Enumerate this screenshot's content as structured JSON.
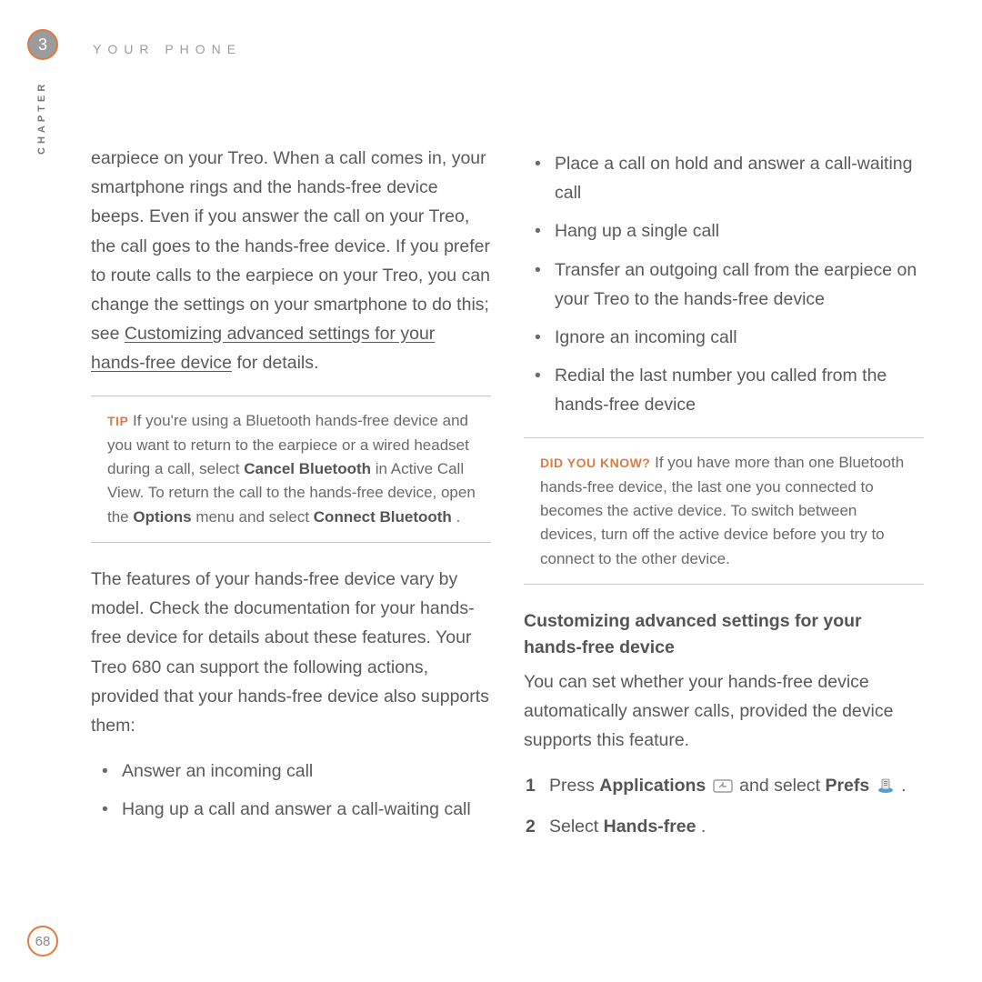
{
  "header": {
    "chapter_num": "3",
    "title": "YOUR PHONE",
    "sidelabel": "CHAPTER",
    "page_num": "68"
  },
  "left": {
    "p1a": "earpiece on your Treo. When a call comes in, your smartphone rings and the hands-free device beeps. Even if you answer the call on your Treo, the call goes to the hands-free device. If you prefer to route calls to the earpiece on your Treo, you can change the settings on your smartphone to do this; see ",
    "p1link": "Customizing advanced settings for your hands-free device",
    "p1b": " for details.",
    "tip": {
      "label": "TIP",
      "t1": "If you're using a Bluetooth hands-free device and you want to return to the earpiece or a wired headset during a call, select ",
      "b1": "Cancel Bluetooth",
      "t2": " in Active Call View. To return the call to the hands-free device, open the ",
      "b2": "Options",
      "t3": " menu and select ",
      "b3": "Connect Bluetooth",
      "t4": "."
    },
    "p2": "The features of your hands-free device vary by model. Check the documentation for your hands-free device for details about these features. Your Treo 680 can support the following actions, provided that your hands-free device also supports them:",
    "bullets": [
      "Answer an incoming call",
      "Hang up a call and answer a call-waiting call"
    ]
  },
  "right": {
    "bullets": [
      "Place a call on hold and answer a call-waiting call",
      "Hang up a single call",
      "Transfer an outgoing call from the earpiece on your Treo to the hands-free device",
      "Ignore an incoming call",
      "Redial the last number you called from the hands-free device"
    ],
    "dyk": {
      "label": "DID YOU KNOW?",
      "text": "If you have more than one Bluetooth hands-free device, the last one you connected to becomes the active device. To switch between devices, turn off the active device before you try to connect to the other device."
    },
    "h3": "Customizing advanced settings for your hands-free device",
    "p2": "You can set whether your hands-free device automatically answer calls, provided the device supports this feature.",
    "steps": {
      "s1a": "Press ",
      "s1b": "Applications",
      "s1c": " and select ",
      "s1d": "Prefs",
      "s1e": " .",
      "s2a": "Select ",
      "s2b": "Hands-free",
      "s2c": "."
    }
  }
}
